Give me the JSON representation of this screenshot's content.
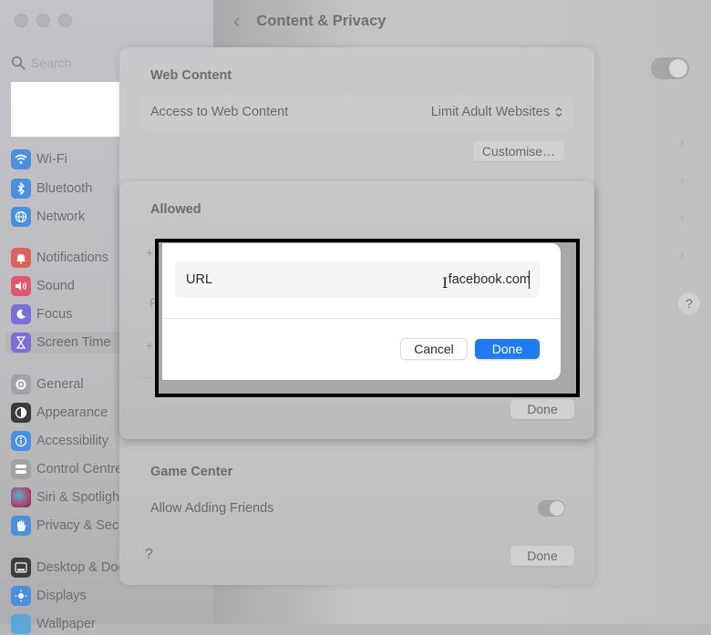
{
  "window": {
    "traffic_lights": [
      "close",
      "minimize",
      "zoom"
    ]
  },
  "sidebar": {
    "search_placeholder": "Search",
    "items": [
      {
        "label": "Wi-Fi",
        "icon": "wifi-icon",
        "color": "#4a8fe0"
      },
      {
        "label": "Bluetooth",
        "icon": "bluetooth-icon",
        "color": "#4a8fe0"
      },
      {
        "label": "Network",
        "icon": "globe-icon",
        "color": "#4a8fe0"
      },
      {
        "label": "Notifications",
        "icon": "bell-icon",
        "color": "#e0615a"
      },
      {
        "label": "Sound",
        "icon": "speaker-icon",
        "color": "#e0586b"
      },
      {
        "label": "Focus",
        "icon": "moon-icon",
        "color": "#7a6fd8"
      },
      {
        "label": "Screen Time",
        "icon": "hourglass-icon",
        "color": "#7a6fd8",
        "selected": true
      },
      {
        "label": "General",
        "icon": "gear-icon",
        "color": "#a2a2a6"
      },
      {
        "label": "Appearance",
        "icon": "appearance-icon",
        "color": "#3b3b3d"
      },
      {
        "label": "Accessibility",
        "icon": "accessibility-icon",
        "color": "#4a8fe0"
      },
      {
        "label": "Control Centre",
        "icon": "control-centre-icon",
        "color": "#a2a2a6"
      },
      {
        "label": "Siri & Spotlight",
        "icon": "siri-icon",
        "color": "#b0466e"
      },
      {
        "label": "Privacy & Security",
        "icon": "hand-icon",
        "color": "#4a8fe0"
      },
      {
        "label": "Desktop & Dock",
        "icon": "dock-icon",
        "color": "#3b3b3d"
      },
      {
        "label": "Displays",
        "icon": "sun-icon",
        "color": "#4a8fe0"
      },
      {
        "label": "Wallpaper",
        "icon": "wallpaper-icon",
        "color": "#5aa8d8"
      }
    ]
  },
  "header": {
    "back_icon": "chevron-left-icon",
    "title": "Content & Privacy"
  },
  "web_content": {
    "section_title": "Web Content",
    "access_label": "Access to Web Content",
    "access_value": "Limit Adult Websites",
    "customise_button": "Customise…"
  },
  "allowed_sheet": {
    "title": "Allowed",
    "done_button": "Done"
  },
  "url_dialog": {
    "field_label": "URL",
    "field_value": "facebook.com",
    "cancel_button": "Cancel",
    "done_button": "Done",
    "accent_color": "#1f7cf0"
  },
  "game_center": {
    "section_title": "Game Center",
    "allow_friends_label": "Allow Adding Friends",
    "allow_friends_on": true
  },
  "footer": {
    "help_label": "?",
    "done_button": "Done"
  },
  "background": {
    "help_label": "?"
  }
}
